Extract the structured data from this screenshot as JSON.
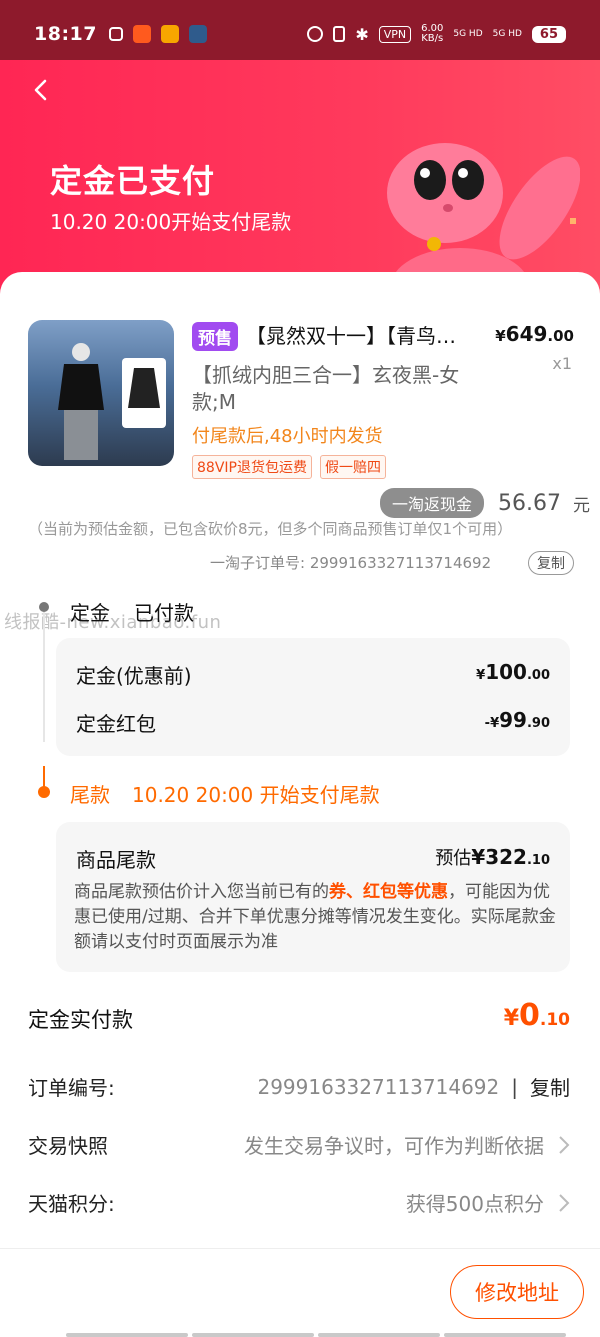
{
  "status_bar": {
    "time": "18:17",
    "vpn": "VPN",
    "speed_value": "6.00",
    "speed_unit": "KB/s",
    "net1": "5G HD",
    "net2": "5G HD",
    "battery": "65"
  },
  "header": {
    "title": "定金已支付",
    "subtitle": "10.20 20:00开始支付尾款"
  },
  "product": {
    "presale_tag": "预售",
    "title": "【晁然双十一】【青鸟…",
    "price_symbol": "¥",
    "price_int": "649",
    "price_dec": ".00",
    "qty": "x1",
    "sku": "【抓绒内胆三合一】玄夜黑-女款;M",
    "shipping": "付尾款后,48小时内发货",
    "badges": [
      "88VIP退货包运费",
      "假一赔四"
    ],
    "cashback_label": "一淘返现金",
    "cashback_amount": "56.67",
    "cashback_unit": "元",
    "estimate_note": "（当前为预估金额，已包含砍价8元，但多个同商品预售订单仅1个可用）",
    "suborder": "一淘子订单号: 2999163327113714692",
    "copy_label": "复制"
  },
  "watermark": "线报酷-new.xianbao.fun",
  "deposit": {
    "label": "定金",
    "status": "已付款",
    "rows": [
      {
        "label": "定金(优惠前)",
        "prefix": "¥",
        "int": "100",
        "dec": ".00"
      },
      {
        "label": "定金红包",
        "prefix": "-¥",
        "int": "99",
        "dec": ".90"
      }
    ]
  },
  "balance": {
    "label": "尾款",
    "time_text": "10.20 20:00 开始支付尾款",
    "item_label": "商品尾款",
    "est_prefix": "预估",
    "est_symbol": "¥",
    "est_int": "322",
    "est_dec": ".10",
    "desc_1": "商品尾款预估价计入您当前已有的",
    "desc_hl1": "券",
    "desc_sep": "、",
    "desc_hl2": "红包等优惠",
    "desc_2": "，可能因为优惠已使用/过期、合并下单优惠分摊等情况发生变化。实际尾款金额请以支付时页面展示为准"
  },
  "paid": {
    "label": "定金实付款",
    "symbol": "¥",
    "int": "0",
    "dec": ".10"
  },
  "info": {
    "order_label": "订单编号:",
    "order_no": "2999163327113714692",
    "order_sep": "|",
    "order_copy": "复制",
    "snapshot_label": "交易快照",
    "snapshot_value": "发生交易争议时，可作为判断依据",
    "points_label": "天猫积分:",
    "points_value": "获得500点积分"
  },
  "bottom": {
    "modify_address": "修改地址"
  },
  "colors": {
    "accent": "#ff5000",
    "header": "#ff2654",
    "presale": "#a14bf0"
  }
}
